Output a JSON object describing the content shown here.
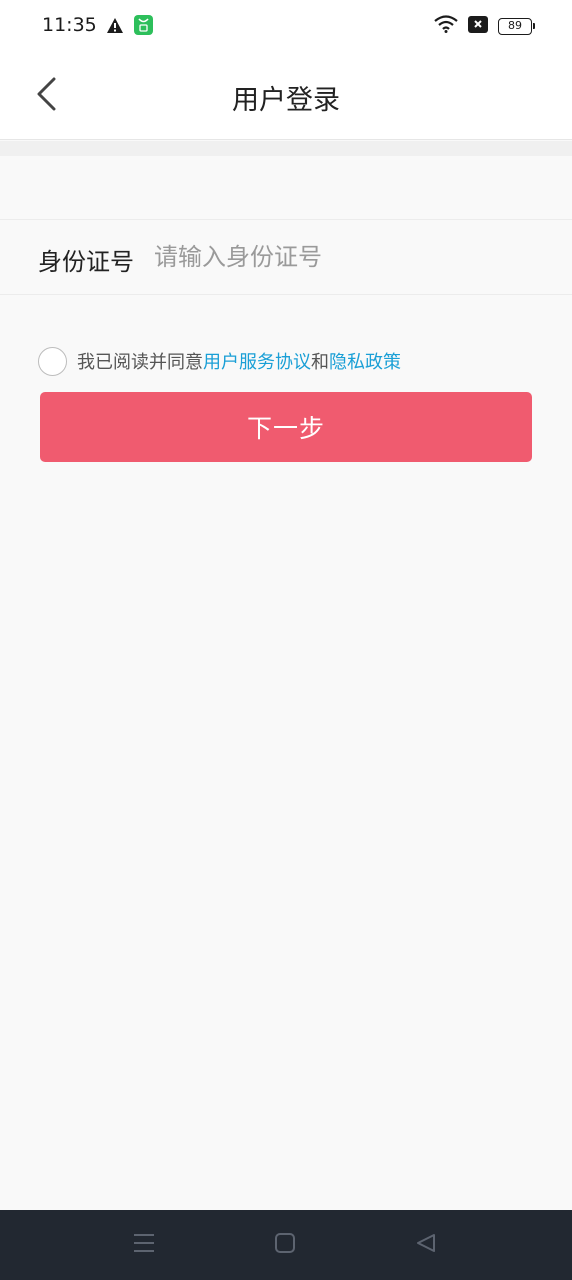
{
  "status_bar": {
    "time": "11:35",
    "battery": "89",
    "icons": [
      "warning-icon",
      "notification-app-icon",
      "wifi-icon",
      "no-sim-icon",
      "battery-icon"
    ]
  },
  "header": {
    "title": "用户登录",
    "back_icon": "chevron-left-icon"
  },
  "form": {
    "id_label": "身份证号",
    "id_value": "",
    "id_placeholder": "请输入身份证号"
  },
  "agreement": {
    "prefix": "我已阅读并同意",
    "link1": "用户服务协议",
    "joiner": "和",
    "link2": "隐私政策",
    "checked": false
  },
  "actions": {
    "next_label": "下一步"
  },
  "colors": {
    "primary": "#f05b6f",
    "link": "#1a9fd6",
    "background": "#f9f9f9",
    "system_nav": "#222831"
  },
  "system_nav": {
    "icons": [
      "menu-icon",
      "home-icon",
      "back-triangle-icon"
    ]
  }
}
